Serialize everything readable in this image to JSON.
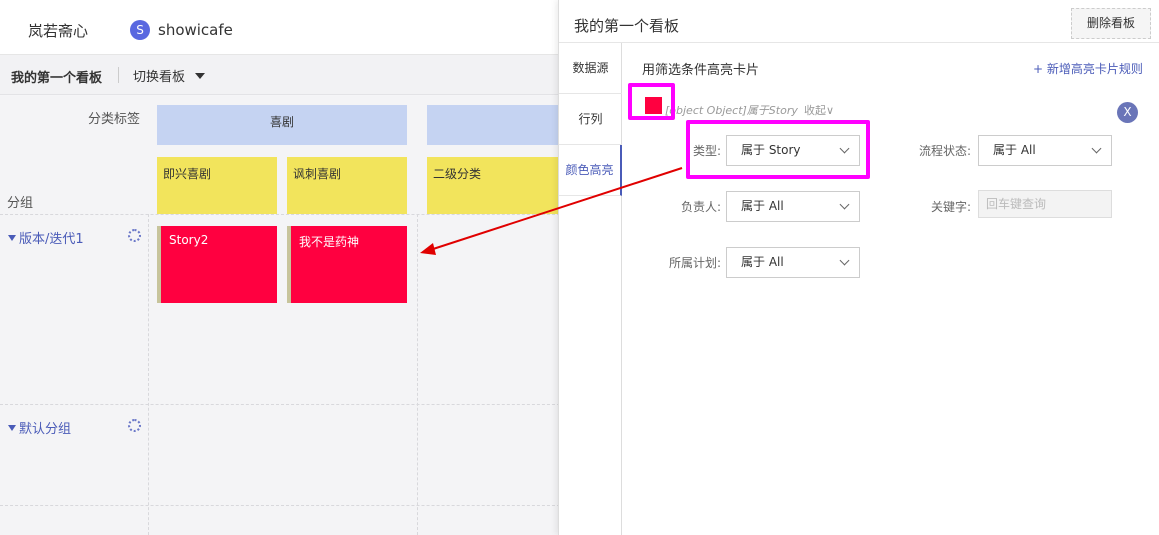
{
  "topnav": {
    "brand": "岚若斋心",
    "project_icon_letter": "S",
    "project_name": "showicafe"
  },
  "boardbar": {
    "board_name": "我的第一个看板",
    "switch_label": "切换看板"
  },
  "board": {
    "category_label": "分类标签",
    "group_label": "分组",
    "columns": [
      {
        "label": "喜剧"
      }
    ],
    "subcolumns": [
      {
        "label": "即兴喜剧"
      },
      {
        "label": "讽刺喜剧"
      },
      {
        "label": "二级分类"
      }
    ],
    "rows": [
      {
        "label": "版本/迭代1"
      },
      {
        "label": "默认分组"
      }
    ],
    "cards": [
      {
        "title": "Story2"
      },
      {
        "title": "我不是药神"
      }
    ]
  },
  "panel": {
    "title": "我的第一个看板",
    "delete_button": "删除看板",
    "tabs": [
      {
        "label": "数据源"
      },
      {
        "label": "行列"
      },
      {
        "label": "颜色高亮"
      }
    ],
    "section_title": "用筛选条件高亮卡片",
    "add_rule": "+ 新增高亮卡片规则",
    "rule_summary": "[object Object]属于Story",
    "collapse_label": "收起∨",
    "close_icon_glyph": "X",
    "highlight_color": "#ff0040",
    "filters": {
      "type": {
        "label": "类型:",
        "value": "属于 Story"
      },
      "status": {
        "label": "流程状态:",
        "value": "属于 All"
      },
      "owner": {
        "label": "负责人:",
        "value": "属于 All"
      },
      "keyword": {
        "label": "关键字:",
        "placeholder": "回车键查询"
      },
      "plan": {
        "label": "所属计划:",
        "value": "属于 All"
      }
    }
  },
  "colors": {
    "accent": "#4a5bb8",
    "card_red": "#ff0040",
    "column_blue": "#c5d3f2",
    "subcolumn_yellow": "#f2e45c",
    "annotation_magenta": "#ff00ff",
    "annotation_arrow": "#e00000"
  }
}
